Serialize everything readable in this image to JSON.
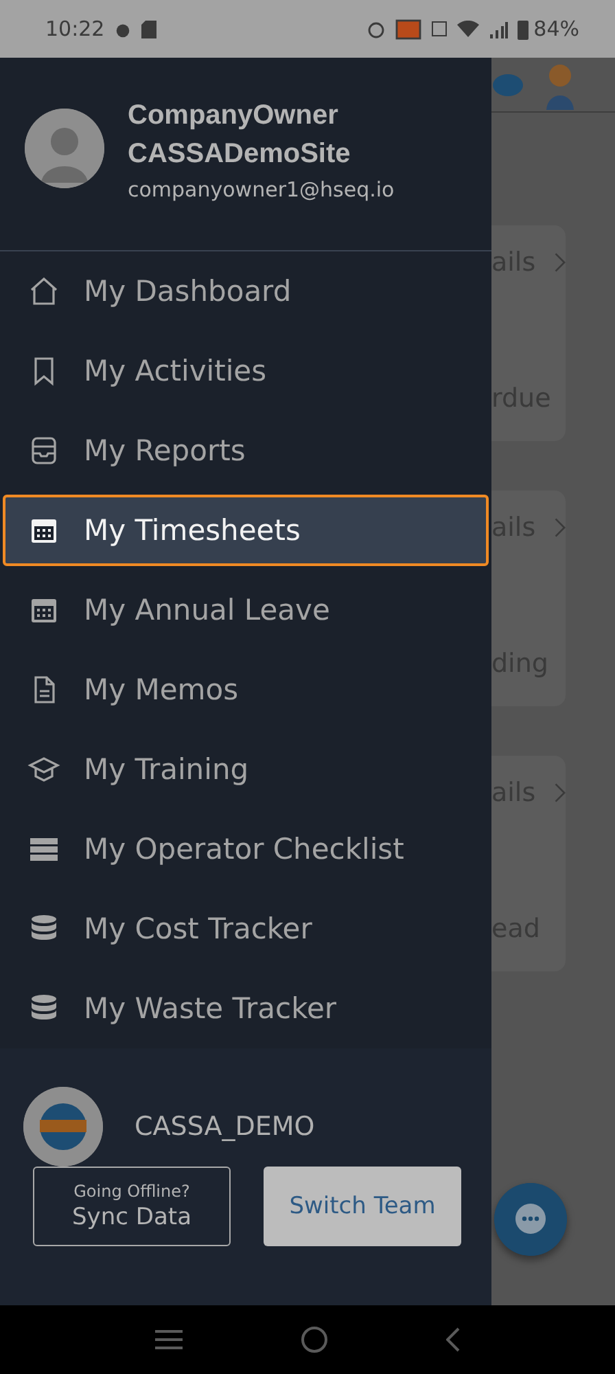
{
  "status_bar": {
    "time": "10:22",
    "battery": "84%"
  },
  "drawer": {
    "profile": {
      "name": "CompanyOwner",
      "site": "CASSADemoSite",
      "email": "companyowner1@hseq.io"
    },
    "menu": [
      {
        "label": "My Dashboard",
        "selected": false
      },
      {
        "label": "My Activities",
        "selected": false
      },
      {
        "label": "My Reports",
        "selected": false
      },
      {
        "label": "My Timesheets",
        "selected": true
      },
      {
        "label": "My Annual Leave",
        "selected": false
      },
      {
        "label": "My Memos",
        "selected": false
      },
      {
        "label": "My Training",
        "selected": false
      },
      {
        "label": "My Operator Checklist",
        "selected": false
      },
      {
        "label": "My Cost Tracker",
        "selected": false
      },
      {
        "label": "My Waste Tracker",
        "selected": false
      }
    ],
    "team": {
      "name": "CASSA_DEMO"
    },
    "sync_button": {
      "caption": "Going Offline?",
      "label": "Sync Data"
    },
    "switch_button": {
      "label": "Switch Team"
    }
  },
  "background_cards": [
    {
      "link": "ails",
      "caption": "rdue"
    },
    {
      "link": "ails",
      "caption": "ding"
    },
    {
      "link": "ails",
      "caption": "ead"
    }
  ]
}
